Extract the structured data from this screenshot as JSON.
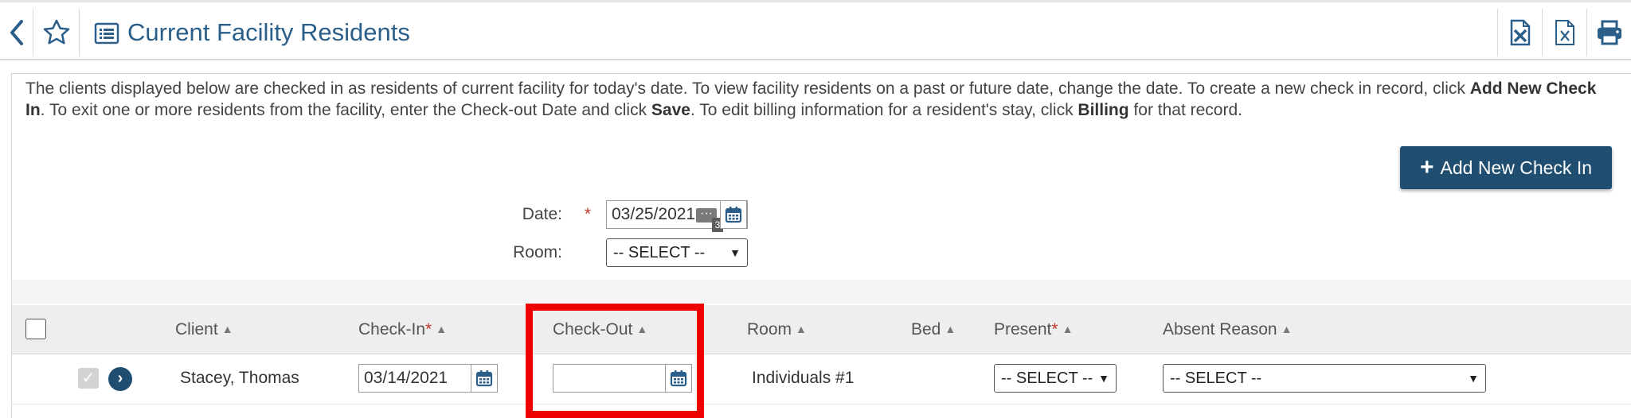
{
  "header": {
    "title": "Current Facility Residents",
    "icons": [
      "back-icon",
      "star-icon",
      "list-icon",
      "excel-export-icon",
      "excel-export-icon",
      "print-icon"
    ]
  },
  "info": {
    "part1": "The clients displayed below are checked in as residents of current facility for today's date.  To view facility residents on a past or future date, change the date.  To create a new check in record, click ",
    "bold1": "Add New Check In",
    "part2": ".  To exit one or more residents from the facility, enter the Check-out Date and click ",
    "bold2": "Save",
    "part3": ".  To edit billing information for a resident's stay, click ",
    "bold3": "Billing",
    "part4": " for that record."
  },
  "add_button": {
    "label": "Add New Check In"
  },
  "filters": {
    "date_label": "Date:",
    "required_mark": "*",
    "date_value": "03/25/2021",
    "date_overlay_dots": "···",
    "date_overlay_badge": "3",
    "room_label": "Room:",
    "room_value": "-- SELECT --"
  },
  "table": {
    "columns": {
      "client": "Client",
      "check_in": "Check-In",
      "check_out": "Check-Out",
      "room": "Room",
      "bed": "Bed",
      "present": "Present",
      "absent_reason": "Absent Reason"
    },
    "rows": [
      {
        "client": "Stacey, Thomas",
        "check_in": "03/14/2021",
        "check_out": "",
        "room": "Individuals #1",
        "bed": "",
        "present": "-- SELECT --",
        "absent_reason": "-- SELECT --"
      }
    ]
  },
  "colors": {
    "primary": "#1f4e70",
    "title": "#2b5f8a",
    "highlight": "#ee0000",
    "required": "#c0392b"
  }
}
